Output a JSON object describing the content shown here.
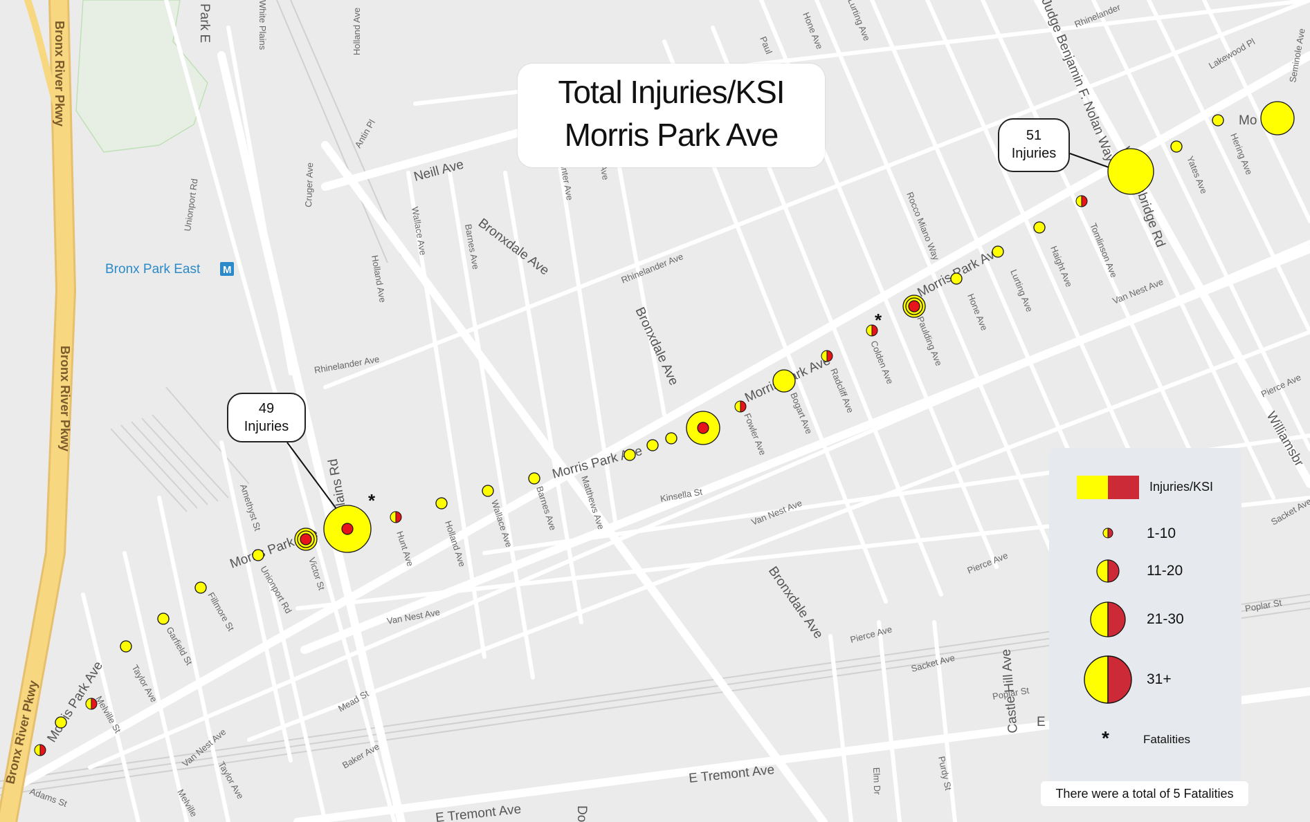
{
  "title": {
    "line1": "Total Injuries/KSI",
    "line2": "Morris Park Ave"
  },
  "poi": {
    "station": "Bronx Park East"
  },
  "streets": {
    "bronx_river_pkwy": "Bronx River Pkwy",
    "bronx_river_pkwy_2": "Bronx River Pkwy",
    "bronx_river_pkwy_3": "Bronx River Pkwy",
    "morris_park_ave_1": "Morris Park Ave",
    "morris_park_ave_2": "Morris Park Ave",
    "morris_park_ave_3": "Morris Park Ave",
    "morris_park_ave_4": "Morris Park Ave",
    "morris_park_ave_5": "Morris Park Ave",
    "bronxdale_ave_1": "Bronxdale Ave",
    "bronxdale_ave_2": "Bronxdale Ave",
    "bronxdale_ave_3": "Bronxdale Ave",
    "white_plains_rd": "White Plains Rd",
    "white_plains_rd_top": "White Plains",
    "neill_ave": "Neill Ave",
    "rhinelander_ave_1": "Rhinelander Ave",
    "rhinelander_ave_2": "Rhinelander Ave",
    "rhinelander_ave_3": "Rhinelander Ave",
    "van_nest_ave_1": "Van Nest Ave",
    "van_nest_ave_2": "Van Nest Ave",
    "van_nest_ave_3": "Van Nest Ave",
    "van_nest_ave_4": "Van Nest Ave",
    "kinsella_st": "Kinsella St",
    "pierce_ave_1": "Pierce Ave",
    "pierce_ave_2": "Pierce Ave",
    "pierce_ave_3": "Pierce Ave",
    "sacket_ave_1": "Sacket Ave",
    "sacket_ave_2": "Sacket Ave",
    "poplar_st_1": "Poplar St",
    "poplar_st_2": "Poplar St",
    "e_tremont_1": "E Tremont Ave",
    "e_tremont_2": "E Tremont Ave",
    "williamsbridge_rd": "Williamsbridge Rd",
    "williamsbridge_2": "Williamsbr",
    "judge_nolan": "Judge Benjamin F. Nolan Way",
    "castle_hill": "Castle Hill Ave",
    "mead_st": "Mead St",
    "baker_ave": "Baker Ave",
    "adams_st": "Adams St",
    "melville_st": "Melville St",
    "melville_2": "Melville",
    "taylor_ave_1": "Taylor Ave",
    "taylor_ave_2": "Taylor Ave",
    "garfield_st": "Garfield St",
    "fillmore_st": "Fillmore St",
    "unionport_rd_1": "Unionport Rd",
    "unionport_rd_2": "Unionport Rd",
    "amethyst_st": "Amethyst St",
    "victor_st": "Victor St",
    "hunt_ave": "Hunt Ave",
    "holland_ave_1": "Holland Ave",
    "holland_ave_2": "Holland Ave",
    "holland_ave_3": "Holland Ave",
    "wallace_ave_1": "Wallace Ave",
    "wallace_ave_2": "Wallace Ave",
    "barnes_ave_1": "Barnes Ave",
    "barnes_ave_2": "Barnes Ave",
    "matthews_ave": "Matthews Ave",
    "fowler_ave": "Fowler Ave",
    "bogart_ave": "Bogart Ave",
    "radcliff_ave": "Radcliff Ave",
    "colden_ave": "Colden Ave",
    "paulding_ave": "Paulding Ave",
    "hone_ave_1": "Hone Ave",
    "hone_ave_2": "Hone Ave",
    "lurting_ave": "Lurting Ave",
    "haight_ave": "Haight Ave",
    "tomlinson_ave": "Tomlinson Ave",
    "yates_ave": "Yates Ave",
    "hering_ave": "Hering Ave",
    "seminole_ave": "Seminole Ave",
    "lakewood_pl": "Lakewood Pl",
    "rocco_miano_way": "Rocco Miano Way",
    "antin_pl": "Antin Pl",
    "cruger_ave": "Cruger Ave",
    "park_e": "Park E",
    "elm_dr": "Elm Dr",
    "purdy_st": "Purdy St",
    "rhinelander_top": "Rhinelander",
    "lurting_top": "Lurting Ave",
    "paulding_top": "Paul",
    "mo_partial": "Mo",
    "linter_ave": "linter Ave",
    "r_ave": "r Ave",
    "e_partial": "E",
    "do_partial": "Do"
  },
  "callouts": [
    {
      "line1": "49",
      "line2": "Injuries"
    },
    {
      "line1": "51",
      "line2": "Injuries"
    }
  ],
  "legend": {
    "header": "Injuries/KSI",
    "rows": [
      "1-10",
      "11-20",
      "21-30",
      "31+"
    ],
    "fatality_symbol": "*",
    "fatality_label": "Fatalities"
  },
  "note": "There were a total of  5 Fatalities",
  "colors": {
    "injury_yellow": "#ffff00",
    "ksi_red": "#cc2a36",
    "center_red": "#e8141c",
    "map_bg": "#ebebeb",
    "road": "#ffffff",
    "highway": "#f7d77f",
    "poi_blue": "#2b8ac9"
  },
  "crash_points": [
    {
      "category": "1-10",
      "type": "split",
      "fatality": false
    },
    {
      "category": "1-10",
      "type": "injury",
      "fatality": false
    },
    {
      "category": "1-10",
      "type": "split",
      "fatality": false
    },
    {
      "category": "1-10",
      "type": "injury",
      "fatality": false
    },
    {
      "category": "1-10",
      "type": "injury",
      "fatality": false
    },
    {
      "category": "1-10",
      "type": "injury",
      "fatality": false
    },
    {
      "category": "1-10",
      "type": "injury",
      "fatality": false
    },
    {
      "category": "1-10",
      "type": "injury",
      "fatality": false
    },
    {
      "category": "11-20",
      "type": "ringed",
      "fatality": false
    },
    {
      "category": "31+",
      "type": "ringed",
      "fatality": true,
      "injuries": 49
    },
    {
      "category": "1-10",
      "type": "split",
      "fatality": false
    },
    {
      "category": "1-10",
      "type": "injury",
      "fatality": false
    },
    {
      "category": "1-10",
      "type": "injury",
      "fatality": false
    },
    {
      "category": "1-10",
      "type": "injury",
      "fatality": false
    },
    {
      "category": "1-10",
      "type": "injury",
      "fatality": false
    },
    {
      "category": "1-10",
      "type": "injury",
      "fatality": false
    },
    {
      "category": "1-10",
      "type": "injury",
      "fatality": false
    },
    {
      "category": "21-30",
      "type": "ringed",
      "fatality": false
    },
    {
      "category": "1-10",
      "type": "split",
      "fatality": false
    },
    {
      "category": "11-20",
      "type": "injury",
      "fatality": false
    },
    {
      "category": "1-10",
      "type": "split",
      "fatality": false
    },
    {
      "category": "1-10",
      "type": "split",
      "fatality": true
    },
    {
      "category": "11-20",
      "type": "ringed",
      "fatality": false
    },
    {
      "category": "1-10",
      "type": "injury",
      "fatality": false
    },
    {
      "category": "1-10",
      "type": "injury",
      "fatality": false
    },
    {
      "category": "1-10",
      "type": "injury",
      "fatality": false
    },
    {
      "category": "1-10",
      "type": "split",
      "fatality": false
    },
    {
      "category": "31+",
      "type": "injury",
      "fatality": false,
      "injuries": 51
    },
    {
      "category": "1-10",
      "type": "injury",
      "fatality": false
    },
    {
      "category": "1-10",
      "type": "injury",
      "fatality": false
    },
    {
      "category": "21-30",
      "type": "injury",
      "fatality": false
    }
  ]
}
